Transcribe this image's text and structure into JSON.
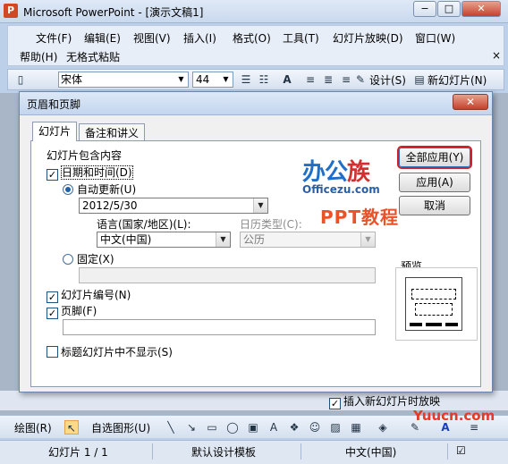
{
  "window": {
    "title": "Microsoft PowerPoint - [演示文稿1]",
    "minimize_glyph": "−",
    "maximize_glyph": "□",
    "close_glyph": "✕"
  },
  "menubar": {
    "items": [
      "文件(F)",
      "编辑(E)",
      "视图(V)",
      "插入(I)",
      "格式(O)",
      "工具(T)",
      "幻灯片放映(D)",
      "窗口(W)"
    ],
    "row2": [
      "帮助(H)",
      "无格式粘贴"
    ],
    "close_glyph": "×"
  },
  "toolbar": {
    "font": "宋体",
    "size": "44",
    "design_label": "设计(S)",
    "new_slide_label": "新幻灯片(N)"
  },
  "dialog": {
    "title": "页眉和页脚",
    "close_glyph": "✕",
    "tabs": [
      "幻灯片",
      "备注和讲义"
    ],
    "group_label": "幻灯片包含内容",
    "date_time_label": "日期和时间(D)",
    "date_time_checked": true,
    "auto_update_label": "自动更新(U)",
    "date_value": "2012/5/30",
    "language_label": "语言(国家/地区)(L):",
    "language_value": "中文(中国)",
    "calendar_label": "日历类型(C):",
    "calendar_value": "公历",
    "fixed_label": "固定(X)",
    "slide_number_label": "幻灯片编号(N)",
    "slide_number_checked": true,
    "footer_label": "页脚(F)",
    "footer_checked": true,
    "hide_title_label": "标题幻灯片中不显示(S)",
    "hide_title_checked": false,
    "buttons": {
      "apply_all": "全部应用(Y)",
      "apply": "应用(A)",
      "cancel": "取消"
    },
    "preview_label": "预览"
  },
  "watermark": {
    "brand_a": "办公",
    "brand_b": "族",
    "url": "Officezu.com",
    "ppt": "PPT教程",
    "site": "Yuucn.com"
  },
  "background": {
    "new_slide_show_label": "插入新幻灯片时放映",
    "new_slide_show_checked": true
  },
  "drawbar": {
    "draw_label": "绘图(R)",
    "autoshape_label": "自选图形(U)"
  },
  "statusbar": {
    "slide_info": "幻灯片 1 / 1",
    "design": "默认设计模板",
    "language": "中文(中国)"
  }
}
